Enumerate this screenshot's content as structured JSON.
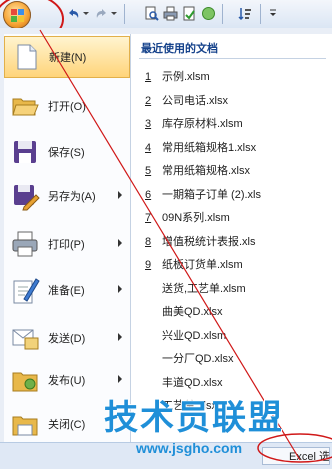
{
  "menu": {
    "items": [
      {
        "label": "新建(N)",
        "icon": "new-document-icon",
        "arrow": false,
        "selected": true
      },
      {
        "label": "打开(O)",
        "icon": "open-folder-icon",
        "arrow": false
      },
      {
        "label": "保存(S)",
        "icon": "save-disk-icon",
        "arrow": false
      },
      {
        "label": "另存为(A)",
        "icon": "save-as-icon",
        "arrow": true
      },
      {
        "label": "打印(P)",
        "icon": "printer-icon",
        "arrow": true
      },
      {
        "label": "准备(E)",
        "icon": "prepare-pen-icon",
        "arrow": true
      },
      {
        "label": "发送(D)",
        "icon": "send-mail-icon",
        "arrow": true
      },
      {
        "label": "发布(U)",
        "icon": "publish-folder-icon",
        "arrow": true
      },
      {
        "label": "关闭(C)",
        "icon": "close-folder-icon",
        "arrow": false
      }
    ]
  },
  "recent": {
    "title": "最近使用的文档",
    "files": [
      {
        "num": "1",
        "name": "示例.xlsm"
      },
      {
        "num": "2",
        "name": "公司电话.xlsx"
      },
      {
        "num": "3",
        "name": "库存原材料.xlsm"
      },
      {
        "num": "4",
        "name": "常用纸箱规格1.xlsx"
      },
      {
        "num": "5",
        "name": "常用纸箱规格.xlsx"
      },
      {
        "num": "6",
        "name": "一期箱子订单 (2).xls"
      },
      {
        "num": "7",
        "name": "09N系列.xlsm"
      },
      {
        "num": "8",
        "name": "增值税统计表报.xls"
      },
      {
        "num": "9",
        "name": "纸板订货单.xlsm"
      },
      {
        "num": "",
        "name": "送货,工艺单.xlsm"
      },
      {
        "num": "",
        "name": "曲美QD.xlsx"
      },
      {
        "num": "",
        "name": "兴业QD.xlsm"
      },
      {
        "num": "",
        "name": "一分厂QD.xlsx"
      },
      {
        "num": "",
        "name": "丰道QD.xlsx"
      },
      {
        "num": "",
        "name": "工艺单.xlsx"
      }
    ]
  },
  "footer": {
    "options_label": "Excel 选项"
  },
  "watermark": {
    "title": "技术员联盟",
    "url": "www.jsgho.com"
  },
  "colors": {
    "accent": "#ffd47a",
    "annotation": "#d01818",
    "watermark": "#1f8fd8"
  }
}
